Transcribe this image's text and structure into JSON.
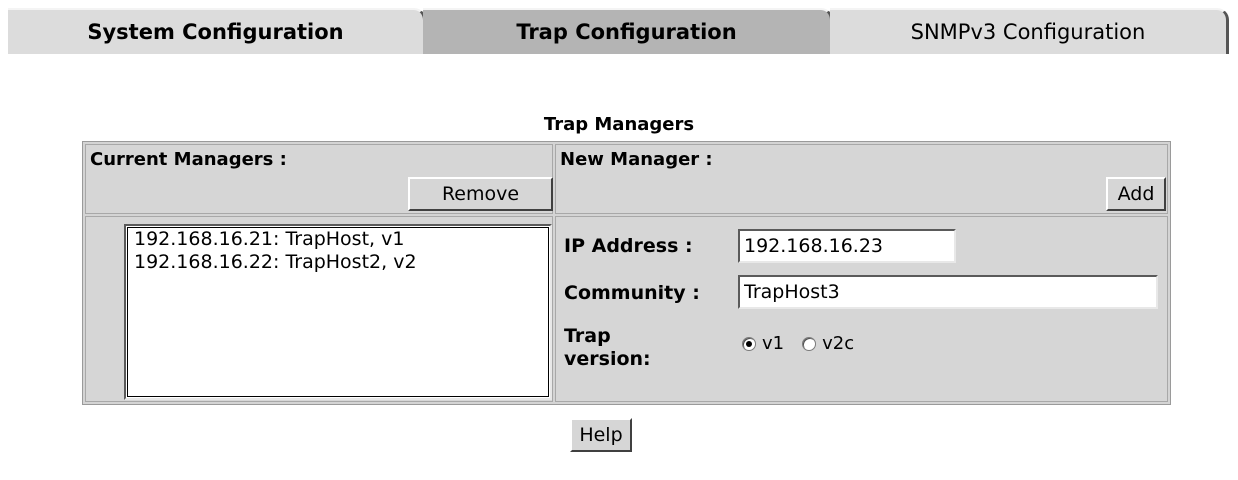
{
  "tabs": [
    {
      "label": "System Configuration",
      "active": false
    },
    {
      "label": "Trap Configuration",
      "active": true
    },
    {
      "label": "SNMPv3 Configuration",
      "active": false
    }
  ],
  "page_title": "Trap Managers",
  "current_managers": {
    "header": "Current Managers :",
    "remove_label": "Remove",
    "items": [
      "192.168.16.21: TrapHost, v1",
      "192.168.16.22: TrapHost2, v2"
    ]
  },
  "new_manager": {
    "header": "New Manager :",
    "add_label": "Add",
    "ip_label": "IP Address :",
    "ip_value": "192.168.16.23",
    "community_label": "Community :",
    "community_value": "TrapHost3",
    "trap_version_label_line1": "Trap",
    "trap_version_label_line2": "version:",
    "versions": [
      {
        "label": "v1",
        "selected": true
      },
      {
        "label": "v2c",
        "selected": false
      }
    ]
  },
  "help_label": "Help"
}
